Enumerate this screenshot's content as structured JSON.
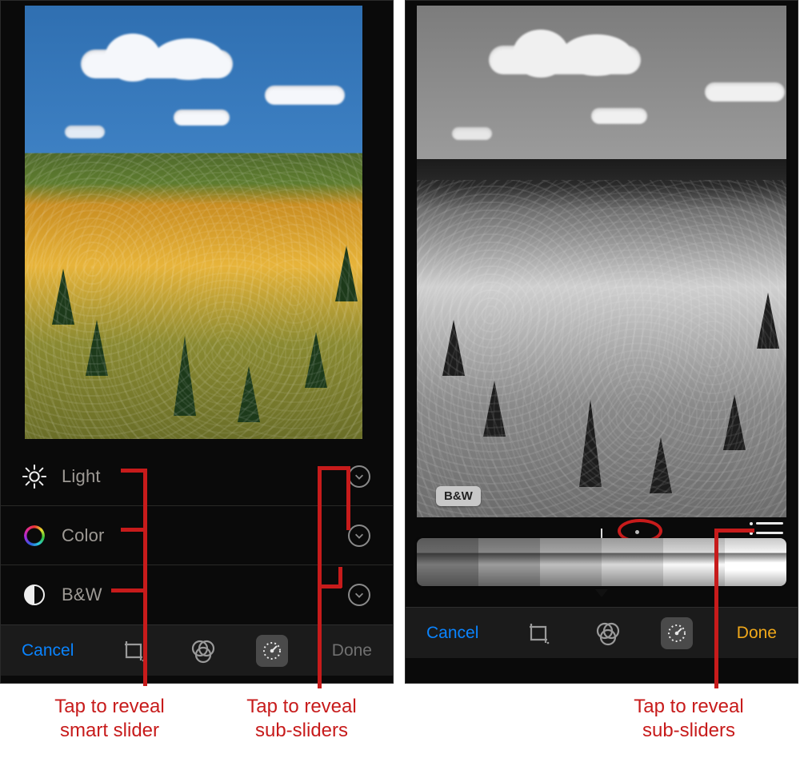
{
  "annotations": {
    "left_labels": "Tap to reveal\nsmart slider",
    "left_chevrons": "Tap to reveal\nsub-sliders",
    "right_list": "Tap to reveal\nsub-sliders"
  },
  "left_phone": {
    "rows": [
      {
        "icon": "sun-icon",
        "label": "Light"
      },
      {
        "icon": "color-ring-icon",
        "label": "Color"
      },
      {
        "icon": "bw-circle-icon",
        "label": "B&W"
      }
    ],
    "toolbar": {
      "cancel": "Cancel",
      "done": "Done",
      "done_active": false,
      "tools": [
        "crop-icon",
        "filters-icon",
        "adjust-dial-icon"
      ]
    }
  },
  "right_phone": {
    "badge": "B&W",
    "has_list_button": true,
    "strip_thumbnails": 6,
    "toolbar": {
      "cancel": "Cancel",
      "done": "Done",
      "done_active": true,
      "tools": [
        "crop-icon",
        "filters-icon",
        "adjust-dial-icon"
      ]
    }
  },
  "colors": {
    "callout": "#c71b1b",
    "ios_blue": "#0a84ff",
    "ios_yellow": "#f0a81a"
  }
}
